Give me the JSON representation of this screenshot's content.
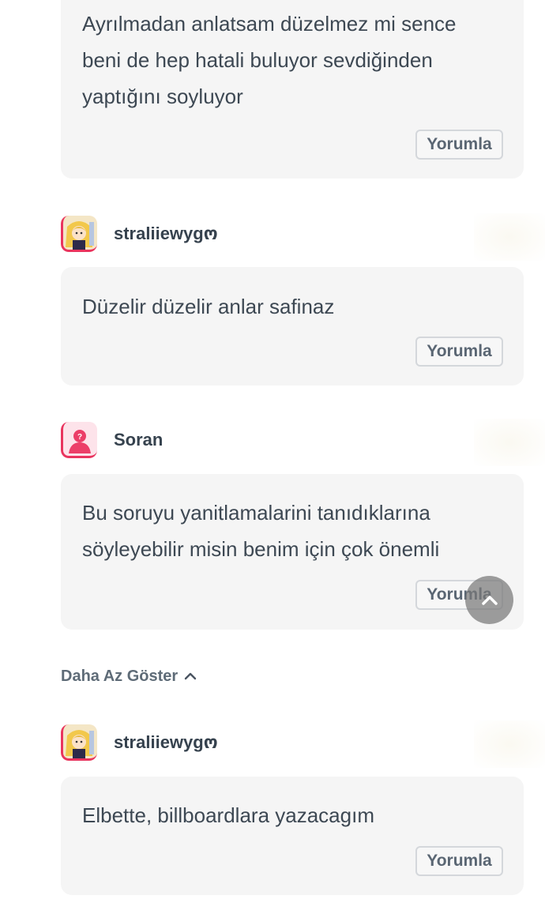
{
  "comments": [
    {
      "text": "Ayrılmadan anlatsam düzelmez mi sence\nbeni de hep hatali buluyor sevdiğinden\nyaptığını soyluyor",
      "reply_label": "Yorumla"
    },
    {
      "username": "straliiewygო",
      "avatar": "anime-girl-avatar",
      "text": "Düzelir düzelir anlar safinaz",
      "reply_label": "Yorumla"
    },
    {
      "username": "Soran",
      "avatar": "anonymous-user-avatar",
      "text": "Bu soruyu yanitlamalarini tanıdıklarına\nsöyleyebilir misin benim için çok önemli",
      "reply_label": "Yorumla"
    },
    {
      "username": "straliiewygო",
      "avatar": "anime-girl-avatar",
      "text": "Elbette, billboardlara yazacagım",
      "reply_label": "Yorumla"
    }
  ],
  "show_less_label": "Daha Az Göster",
  "icons": {
    "show_less": "chevron-up-icon",
    "scroll_top": "chevron-up-icon"
  },
  "colors": {
    "accent": "#e9345e",
    "card_bg": "#f5f5f5",
    "text": "#3d4853"
  }
}
